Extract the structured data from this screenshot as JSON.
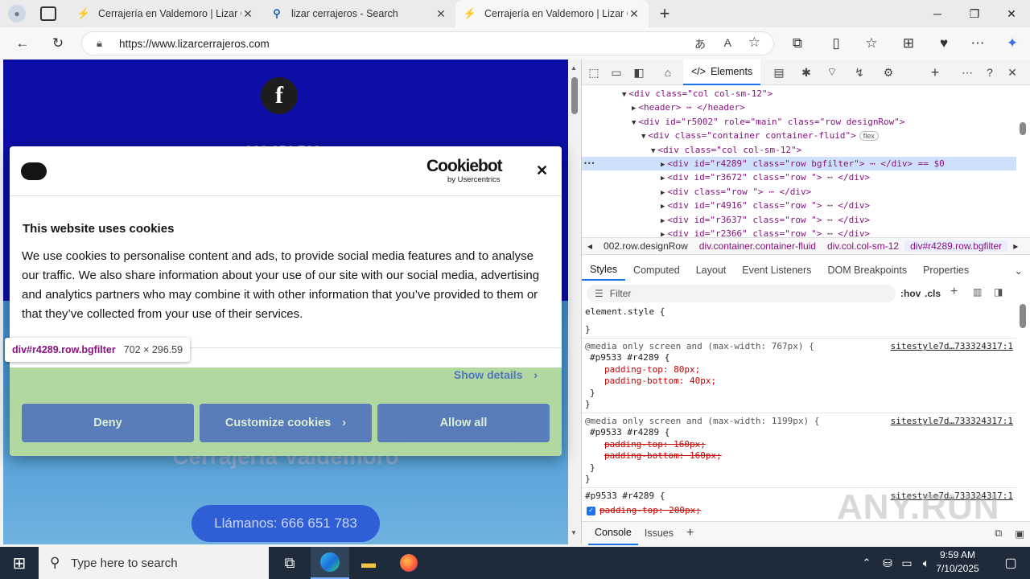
{
  "browser": {
    "tabs": [
      {
        "title": "Cerrajería en Valdemoro | Lizar Ce",
        "active": false
      },
      {
        "title": "lizar cerrajeros - Search",
        "active": false
      },
      {
        "title": "Cerrajería en Valdemoro | Lizar Ce",
        "active": true
      }
    ],
    "new_tab": "+",
    "url": "https://www.lizarcerrajeros.com"
  },
  "page": {
    "site_title": "Cerrajería Valdemoro",
    "call_button": "Llámanos: 666 651 783",
    "phone_partial": "666 651 783"
  },
  "cookie": {
    "logo_brand": "Cookiebot",
    "logo_sub": "by Usercentrics",
    "title": "This website uses cookies",
    "body": "We use cookies to personalise content and ads, to provide social media features and to analyse our traffic. We also share information about your use of our site with our social media, advertising and analytics partners who may combine it with other information that you’ve provided to them or that they’ve collected from your use of their services.",
    "show_details": "Show details",
    "deny": "Deny",
    "customize": "Customize cookies",
    "allow_all": "Allow all",
    "close": "✕"
  },
  "inspect_tooltip": {
    "selector": "div#r4289.row.bgfilter",
    "size": "702 × 296.59"
  },
  "devtools": {
    "elements_tab": "Elements",
    "flex_badge": "flex",
    "dom_lines": [
      {
        "indent": 1,
        "arrow": "▼",
        "html": "<div class=\"col col-sm-12\">"
      },
      {
        "indent": 2,
        "arrow": "▶",
        "html": "<header> ⋯ </header>"
      },
      {
        "indent": 2,
        "arrow": "▼",
        "html": "<div id=\"r5002\" role=\"main\" class=\"row designRow\">"
      },
      {
        "indent": 3,
        "arrow": "▼",
        "html": "<div class=\"container container-fluid\">"
      },
      {
        "indent": 4,
        "arrow": "▼",
        "html": "<div class=\"col col-sm-12\">"
      },
      {
        "indent": 5,
        "arrow": "▶",
        "html": "<div id=\"r4289\" class=\"row bgfilter\"> ⋯ </div> == $0"
      },
      {
        "indent": 5,
        "arrow": "▶",
        "html": "<div id=\"r3672\" class=\"row \"> ⋯ </div>"
      },
      {
        "indent": 5,
        "arrow": "▶",
        "html": "<div class=\"row \"> ⋯ </div>"
      },
      {
        "indent": 5,
        "arrow": "▶",
        "html": "<div id=\"r4916\" class=\"row \"> ⋯ </div>"
      },
      {
        "indent": 5,
        "arrow": "▶",
        "html": "<div id=\"r3637\" class=\"row \"> ⋯ </div>"
      },
      {
        "indent": 5,
        "arrow": "▶",
        "html": "<div id=\"r2366\" class=\"row \"> ⋯ </div>"
      }
    ],
    "breadcrumbs": [
      "002.row.designRow",
      "div.container.container-fluid",
      "div.col.col-sm-12",
      "div#r4289.row.bgfilter"
    ],
    "style_tabs": [
      "Styles",
      "Computed",
      "Layout",
      "Event Listeners",
      "DOM Breakpoints",
      "Properties"
    ],
    "filter_placeholder": "Filter",
    "hov": ":hov",
    "cls": ".cls",
    "css_lines": [
      "element.style {",
      "}",
      "@media only screen and (max-width: 767px) {",
      "#p9533 #r4289 {",
      "padding-top: 80px;",
      "padding-bottom: 40px;",
      "}",
      "}",
      "@media only screen and (max-width: 1199px) {",
      "#p9533 #r4289 {",
      "padding-top: 160px;",
      "padding-bottom: 160px;",
      "}",
      "}",
      "#p9533 #r4289 {",
      "padding-top: 200px;"
    ],
    "source_link": "sitestyle7d…733324317:1",
    "drawer_tabs": [
      "Console",
      "Issues"
    ]
  },
  "taskbar": {
    "search_placeholder": "Type here to search",
    "time": "9:59 AM",
    "date": "7/10/2025"
  },
  "watermark": "ANY.RUN",
  "colors": {
    "page_bg": "#0d0da8",
    "cookie_accent": "#1032cf",
    "devtools_select": "#cfe0fb",
    "taskbar": "#1d2b3a"
  }
}
